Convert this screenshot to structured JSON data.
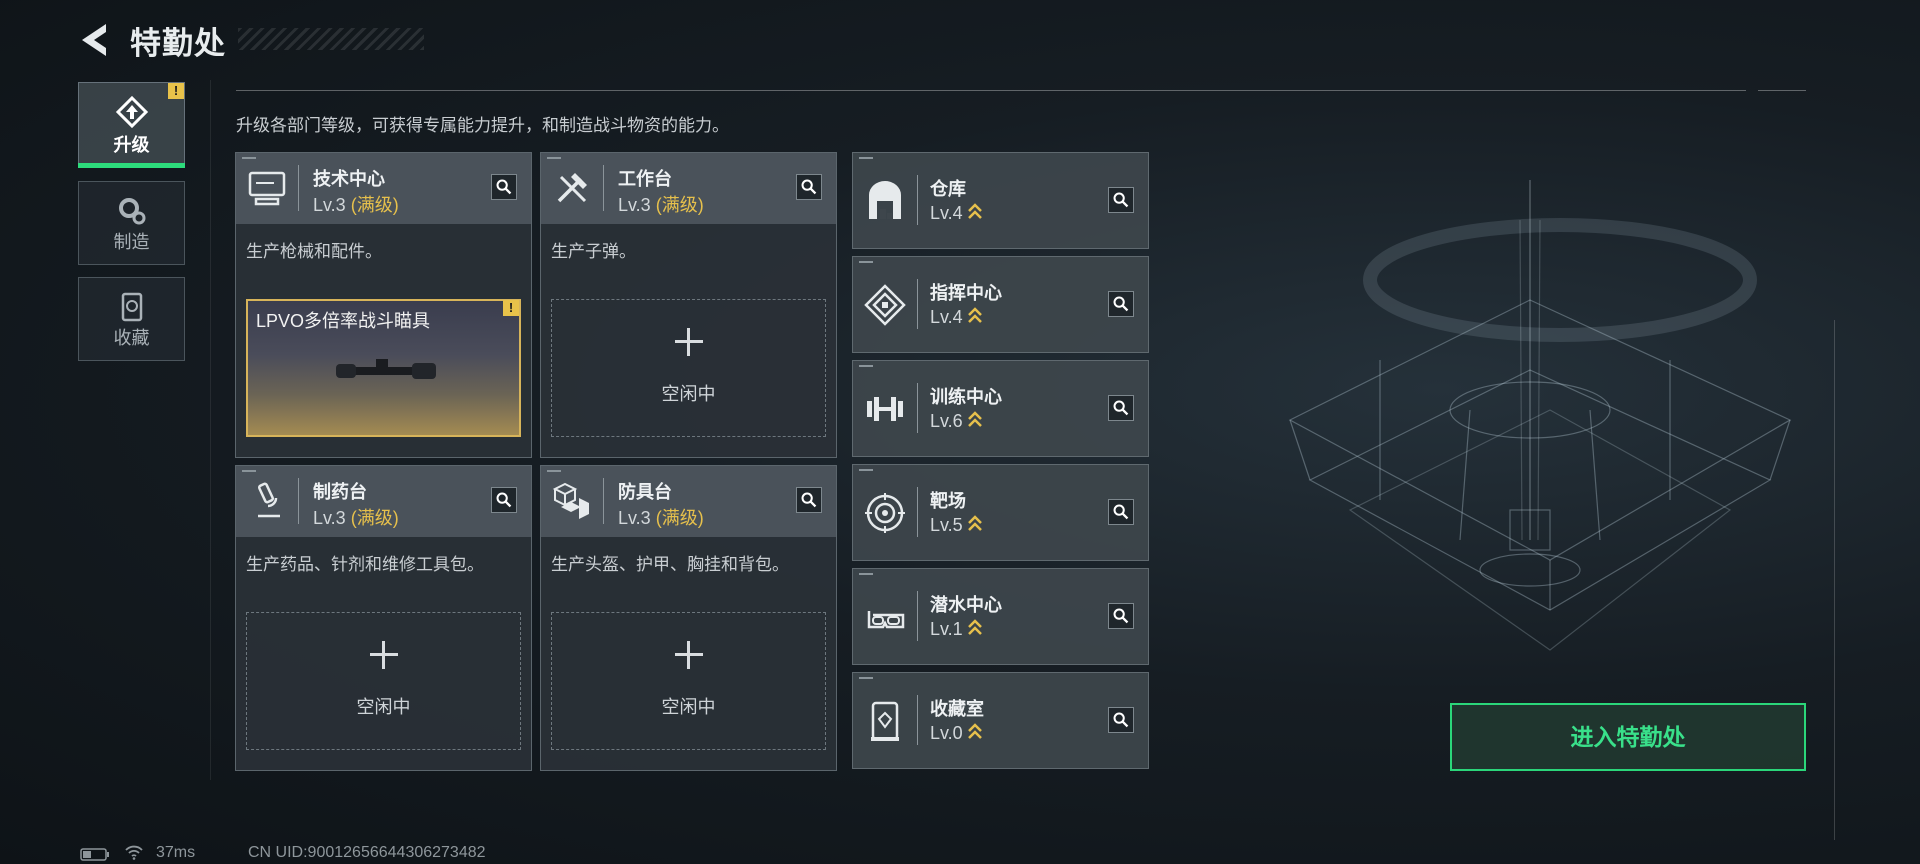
{
  "header": {
    "title": "特勤处"
  },
  "nav": [
    {
      "label": "升级",
      "active": true,
      "alert": "!"
    },
    {
      "label": "制造",
      "active": false
    },
    {
      "label": "收藏",
      "active": false
    }
  ],
  "description": "升级各部门等级，可获得专属能力提升，和制造战斗物资的能力。",
  "workshops": [
    {
      "name": "技术中心",
      "level": "Lv.3",
      "max_tag": "(满级)",
      "desc": "生产枪械和配件。",
      "icon": "computer-icon",
      "slot": {
        "state": "active",
        "item": "LPVO多倍率战斗瞄具",
        "alert": "!"
      }
    },
    {
      "name": "工作台",
      "level": "Lv.3",
      "max_tag": "(满级)",
      "desc": "生产子弹。",
      "icon": "tools-icon",
      "slot": {
        "state": "idle",
        "label": "空闲中"
      }
    },
    {
      "name": "制药台",
      "level": "Lv.3",
      "max_tag": "(满级)",
      "desc": "生产药品、针剂和维修工具包。",
      "icon": "microscope-icon",
      "slot": {
        "state": "idle",
        "label": "空闲中"
      }
    },
    {
      "name": "防具台",
      "level": "Lv.3",
      "max_tag": "(满级)",
      "desc": "生产头盔、护甲、胸挂和背包。",
      "icon": "armor-boxes-icon",
      "slot": {
        "state": "idle",
        "label": "空闲中"
      }
    }
  ],
  "facilities": [
    {
      "name": "仓库",
      "level": "Lv.4",
      "icon": "warehouse-icon"
    },
    {
      "name": "指挥中心",
      "level": "Lv.4",
      "icon": "command-icon"
    },
    {
      "name": "训练中心",
      "level": "Lv.6",
      "icon": "dumbbell-icon"
    },
    {
      "name": "靶场",
      "level": "Lv.5",
      "icon": "target-icon"
    },
    {
      "name": "潜水中心",
      "level": "Lv.1",
      "icon": "diving-mask-icon"
    },
    {
      "name": "收藏室",
      "level": "Lv.0",
      "icon": "collection-icon"
    }
  ],
  "enter_button": "进入特勤处",
  "footer": {
    "ping": "37ms",
    "uid": "CN UID:900126566443062734​82"
  },
  "colors": {
    "accent": "#2ddc7c",
    "max_level": "#e6c04c",
    "alert": "#e8c24a"
  }
}
